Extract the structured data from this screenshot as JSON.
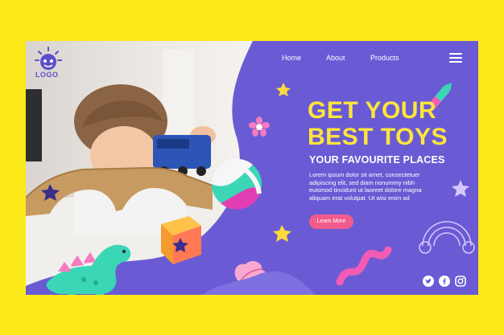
{
  "brand": {
    "logo_text": "LOGO"
  },
  "nav": {
    "items": [
      {
        "label": "Home"
      },
      {
        "label": "About"
      },
      {
        "label": "Products"
      }
    ]
  },
  "hero": {
    "headline_line1": "GET YOUR",
    "headline_line2": "BEST TOYS",
    "subheadline": "YOUR FAVOURITE PLACES",
    "body_line1": "Lorem ipsum dolor sit amet, consectetuer",
    "body_line2": "adipiscing elit, sed diam nonummy nibh",
    "body_line3": "euismod tincidunt ut laoreet dolore magna",
    "body_line4": "aliquam erat volutpat. Ut wisi enim ad",
    "cta_label": "Learn More"
  },
  "social": {
    "icons": [
      "twitter-icon",
      "facebook-icon",
      "instagram-icon"
    ]
  },
  "colors": {
    "frame": "#fbe91a",
    "card": "#6a5bd4",
    "headline": "#ffe53d",
    "cta": "#f25b8b"
  }
}
